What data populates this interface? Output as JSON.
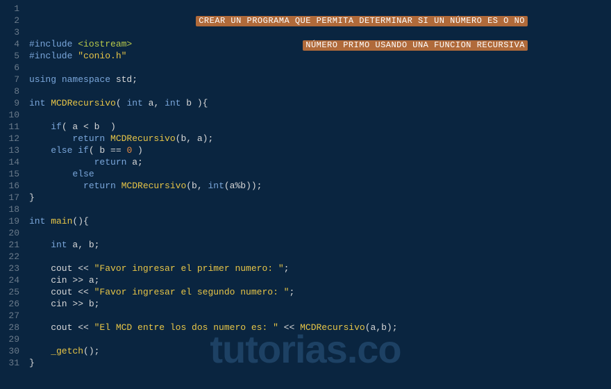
{
  "banner": {
    "line1": "CREAR UN PROGRAMA QUE PERMITA DETERMINAR SI UN NÚMERO ES O NO",
    "line2": "NÚMERO PRIMO USANDO UNA FUNCION RECURSIVA"
  },
  "watermark": "tutorias.co",
  "lines": {
    "l4a": "#include ",
    "l4b": "<iostream>",
    "l5a": "#include ",
    "l5b": "\"conio.h\"",
    "l7a": "using",
    "l7b": " namespace",
    "l7c": " std",
    "l7d": ";",
    "l9a": "int",
    "l9b": " MCDRecursivo",
    "l9c": "( ",
    "l9d": "int",
    "l9e": " a, ",
    "l9f": "int",
    "l9g": " b ){",
    "l11a": "    if",
    "l11b": "( a < b  )",
    "l12a": "        return",
    "l12b": " MCDRecursivo",
    "l12c": "(b, a);",
    "l13a": "    else if",
    "l13b": "( b == ",
    "l13c": "0",
    "l13d": " )",
    "l14a": "            return",
    "l14b": " a;",
    "l15a": "        else",
    "l16a": "          return",
    "l16b": " MCDRecursivo",
    "l16c": "(b, ",
    "l16d": "int",
    "l16e": "(a%b));",
    "l17a": "}",
    "l19a": "int",
    "l19b": " main",
    "l19c": "(){",
    "l21a": "    int",
    "l21b": " a, b;",
    "l23a": "    cout << ",
    "l23b": "\"Favor ingresar el primer numero: \"",
    "l23c": ";",
    "l24a": "    cin >> a;",
    "l25a": "    cout << ",
    "l25b": "\"Favor ingresar el segundo numero: \"",
    "l25c": ";",
    "l26a": "    cin >> b;",
    "l28a": "    cout << ",
    "l28b": "\"El MCD entre los dos numero es: \"",
    "l28c": " << ",
    "l28d": "MCDRecursivo",
    "l28e": "(a,b);",
    "l30a": "    _getch",
    "l30b": "();",
    "l31a": "}"
  },
  "gutter": [
    "1",
    "2",
    "3",
    "4",
    "5",
    "6",
    "7",
    "8",
    "9",
    "10",
    "11",
    "12",
    "13",
    "14",
    "15",
    "16",
    "17",
    "18",
    "19",
    "20",
    "21",
    "22",
    "23",
    "24",
    "25",
    "26",
    "27",
    "28",
    "29",
    "30",
    "31"
  ]
}
